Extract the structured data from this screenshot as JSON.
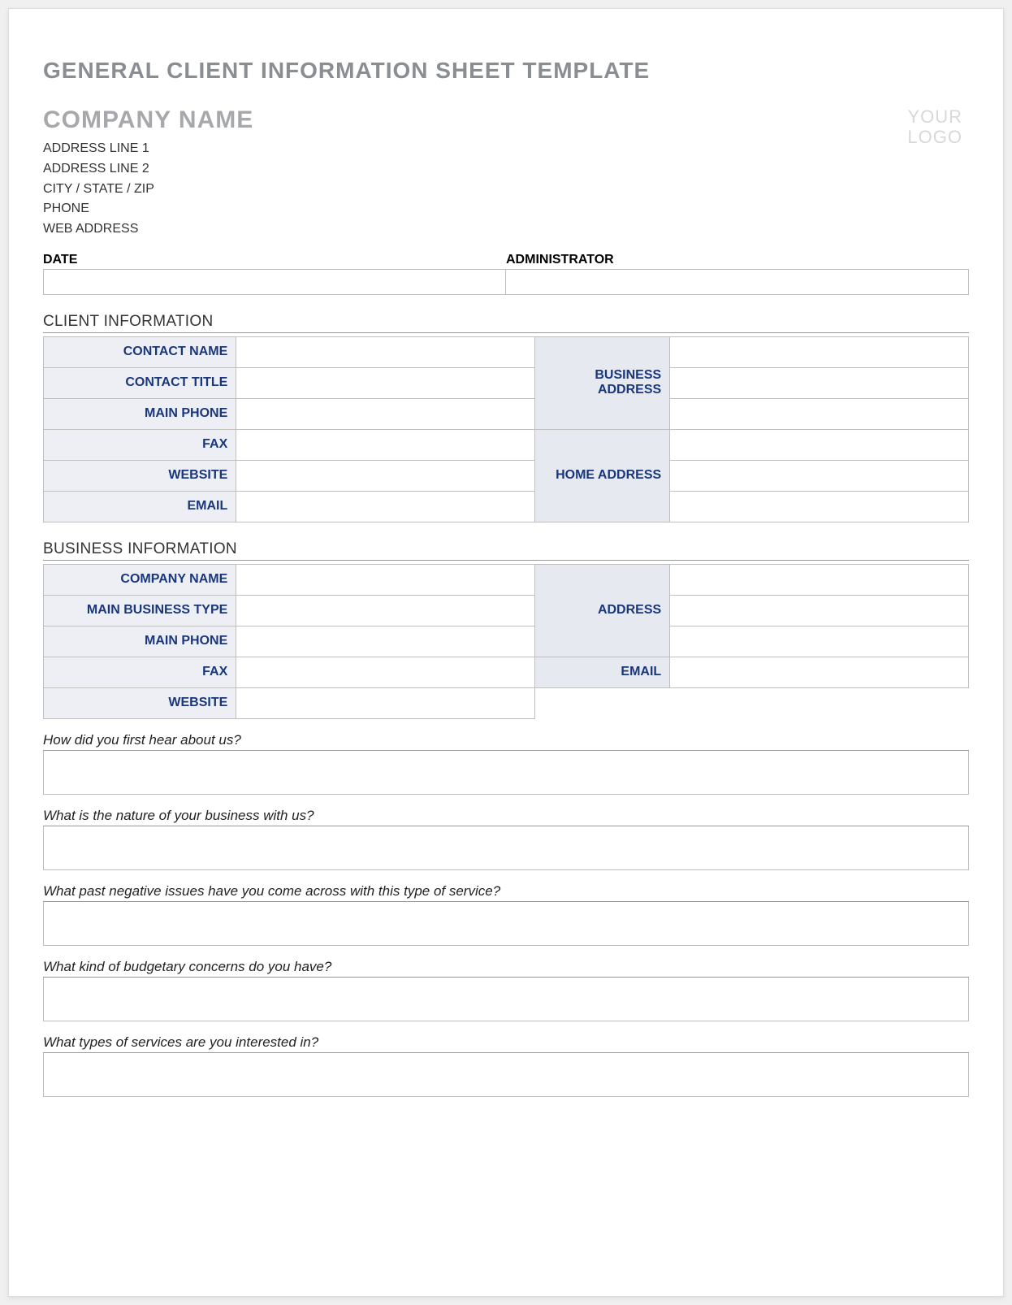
{
  "doc_title": "GENERAL CLIENT INFORMATION SHEET TEMPLATE",
  "company": {
    "name": "COMPANY NAME",
    "address1": "ADDRESS LINE 1",
    "address2": "ADDRESS LINE 2",
    "citystatezip": "CITY / STATE / ZIP",
    "phone": "PHONE",
    "web": "WEB ADDRESS"
  },
  "logo": {
    "line1": "YOUR",
    "line2": "LOGO"
  },
  "date_admin": {
    "date_label": "DATE",
    "admin_label": "ADMINISTRATOR"
  },
  "client_section": {
    "heading": "CLIENT INFORMATION",
    "labels": {
      "contact_name": "CONTACT NAME",
      "contact_title": "CONTACT TITLE",
      "main_phone": "MAIN PHONE",
      "fax": "FAX",
      "website": "WEBSITE",
      "email": "EMAIL",
      "business_address": "BUSINESS ADDRESS",
      "home_address": "HOME ADDRESS"
    }
  },
  "business_section": {
    "heading": "BUSINESS INFORMATION",
    "labels": {
      "company_name": "COMPANY NAME",
      "main_business_type": "MAIN BUSINESS TYPE",
      "main_phone": "MAIN PHONE",
      "fax": "FAX",
      "website": "WEBSITE",
      "address": "ADDRESS",
      "email": "EMAIL"
    }
  },
  "questions": {
    "q1": "How did you first hear about us?",
    "q2": "What is the nature of your business with us?",
    "q3": "What past negative issues have you come across with this type of service?",
    "q4": "What kind of budgetary concerns do you have?",
    "q5": "What types of services are you interested in?"
  }
}
